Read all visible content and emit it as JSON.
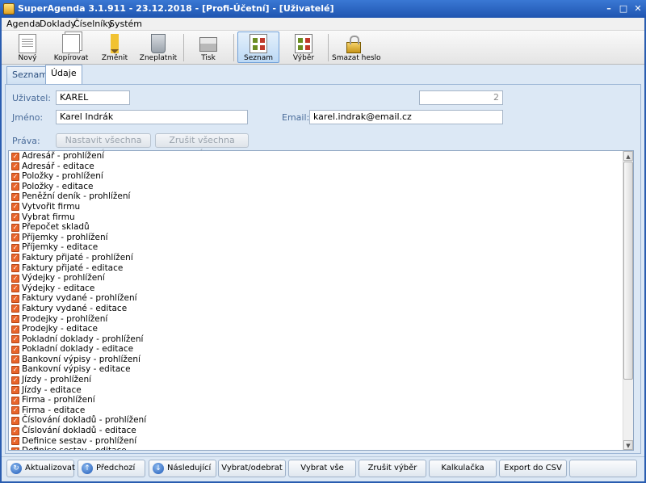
{
  "window": {
    "title": "SuperAgenda 3.1.911 - 23.12.2018 - [Profi-Účetní] - [Uživatelé]"
  },
  "menu": [
    "Agenda",
    "Doklady",
    "Číselníky",
    "Systém"
  ],
  "toolbar": [
    {
      "label": "Nový",
      "icon": "new-document-icon"
    },
    {
      "label": "Kopírovat",
      "icon": "copy-document-icon"
    },
    {
      "label": "Změnit",
      "icon": "pencil-icon"
    },
    {
      "label": "Zneplatnit",
      "icon": "trash-icon"
    },
    {
      "label": "Tisk",
      "icon": "printer-icon"
    },
    {
      "label": "Seznam",
      "icon": "list-view-icon",
      "active": true
    },
    {
      "label": "Výběr",
      "icon": "filter-view-icon"
    },
    {
      "label": "Smazat heslo",
      "icon": "lock-icon"
    }
  ],
  "tabs": [
    {
      "label": "Seznam"
    },
    {
      "label": "Údaje",
      "active": true
    }
  ],
  "form": {
    "user_label": "Uživatel:",
    "user_value": "KAREL",
    "id_value": "2",
    "name_label": "Jméno:",
    "name_value": "Karel Indrák",
    "email_label": "Email:",
    "email_value": "karel.indrak@email.cz",
    "rights_label": "Práva:",
    "set_all_label": "Nastavit všechna práva",
    "clear_all_label": "Zrušit všechna práva"
  },
  "rights": [
    "Adresář - prohlížení",
    "Adresář - editace",
    "Položky - prohlížení",
    "Položky - editace",
    "Peněžní deník - prohlížení",
    "Vytvořit firmu",
    "Vybrat firmu",
    "Přepočet skladů",
    "Příjemky - prohlížení",
    "Příjemky - editace",
    "Faktury přijaté - prohlížení",
    "Faktury přijaté - editace",
    "Výdejky - prohlížení",
    "Výdejky - editace",
    "Faktury vydané - prohlížení",
    "Faktury vydané - editace",
    "Prodejky - prohlížení",
    "Prodejky - editace",
    "Pokladní doklady - prohlížení",
    "Pokladní doklady - editace",
    "Bankovní výpisy - prohlížení",
    "Bankovní výpisy - editace",
    "Jízdy - prohlížení",
    "Jízdy - editace",
    "Firma - prohlížení",
    "Firma - editace",
    "Číslování dokladů - prohlížení",
    "Číslování dokladů - editace",
    "Definice sestav - prohlížení",
    "Definice sestav - editace"
  ],
  "bottom": [
    {
      "label": "Aktualizovat",
      "icon": "refresh-icon"
    },
    {
      "label": "Předchozí",
      "icon": "arrow-up-icon"
    },
    {
      "label": "Následující",
      "icon": "arrow-down-icon"
    },
    {
      "label": "Vybrat/odebrat"
    },
    {
      "label": "Vybrat vše"
    },
    {
      "label": "Zrušit výběr"
    },
    {
      "label": "Kalkulačka"
    },
    {
      "label": "Export do CSV"
    },
    {
      "label": ""
    }
  ],
  "colors": {
    "title_bar": "#2a66c8",
    "panel_bg": "#dce8f5",
    "checkbox": "#e8642a",
    "label_text": "#4a6c9a"
  }
}
